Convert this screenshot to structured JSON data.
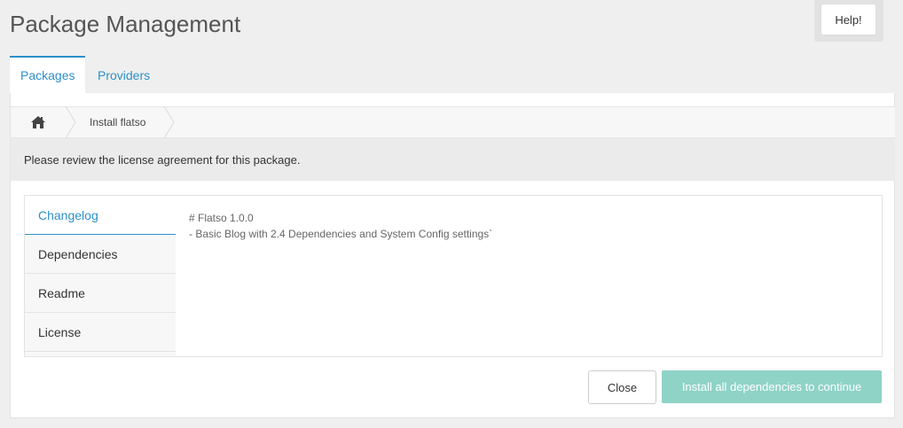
{
  "header": {
    "title": "Package Management",
    "help_label": "Help!"
  },
  "tabs": [
    {
      "label": "Packages",
      "active": true
    },
    {
      "label": "Providers",
      "active": false
    }
  ],
  "breadcrumb": {
    "home_icon": "home-icon",
    "current": "Install flatso"
  },
  "notice": "Please review the license agreement for this package.",
  "side_tabs": [
    {
      "label": "Changelog",
      "active": true
    },
    {
      "label": "Dependencies",
      "active": false
    },
    {
      "label": "Readme",
      "active": false
    },
    {
      "label": "License",
      "active": false
    }
  ],
  "changelog": {
    "line1": "# Flatso 1.0.0",
    "line2": "- Basic Blog with 2.4 Dependencies and System Config settings`"
  },
  "footer": {
    "close_label": "Close",
    "install_label": "Install all dependencies to continue",
    "install_disabled": true
  },
  "colors": {
    "accent": "#2d8fc7",
    "install_disabled_bg": "#8fd3c7"
  }
}
